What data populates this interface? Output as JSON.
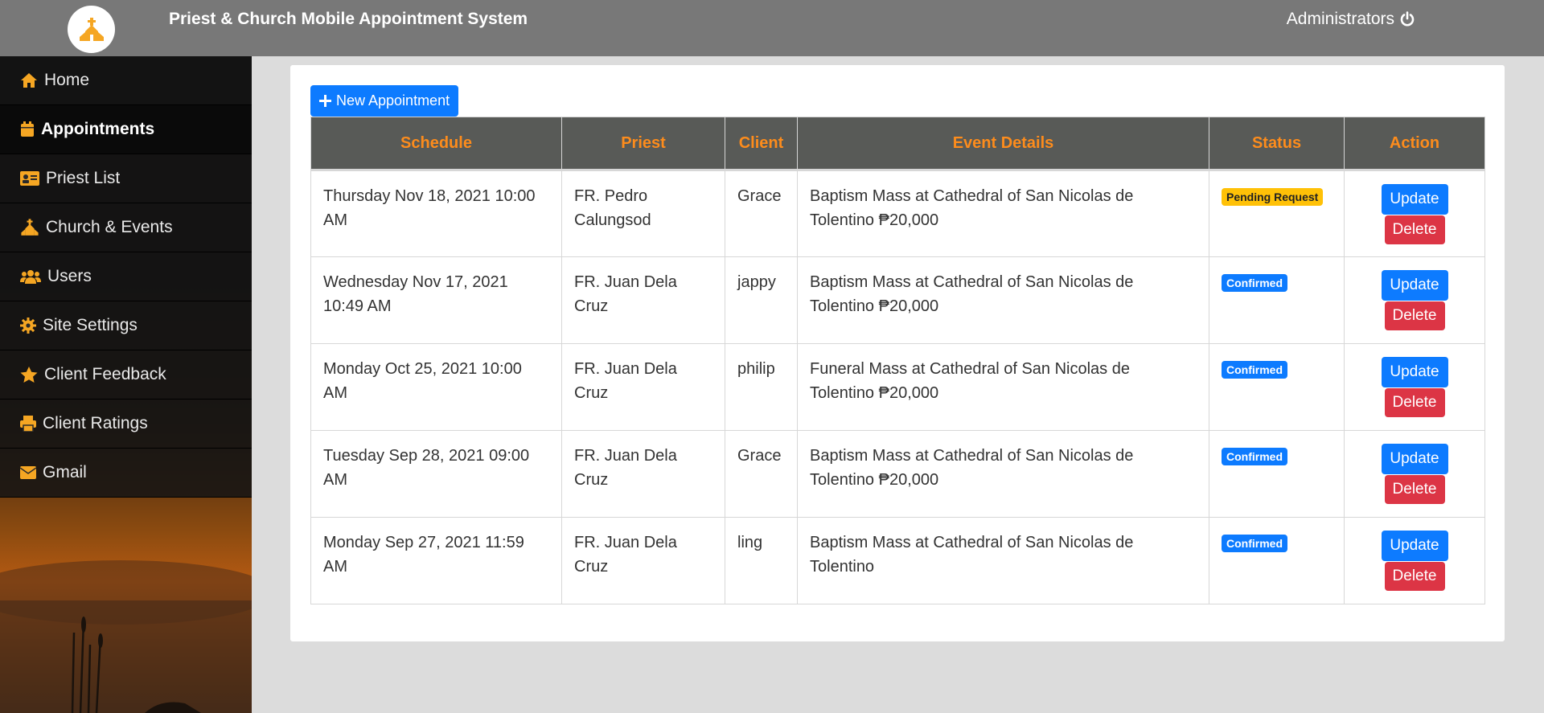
{
  "header": {
    "app_title": "Priest & Church Mobile Appointment System",
    "user_label": "Administrators",
    "logo_icon": "church-icon",
    "logout_icon": "power-icon",
    "accent_color": "#f5a623"
  },
  "sidebar": {
    "items": [
      {
        "label": "Home",
        "icon": "home-icon"
      },
      {
        "label": "Appointments",
        "icon": "calendar-icon",
        "active": true
      },
      {
        "label": "Priest List",
        "icon": "id-card-icon"
      },
      {
        "label": "Church & Events",
        "icon": "church-icon"
      },
      {
        "label": "Users",
        "icon": "users-icon"
      },
      {
        "label": "Site Settings",
        "icon": "gear-icon"
      },
      {
        "label": "Client Feedback",
        "icon": "star-icon"
      },
      {
        "label": "Client Ratings",
        "icon": "print-icon"
      },
      {
        "label": "Gmail",
        "icon": "envelope-icon"
      }
    ]
  },
  "main": {
    "new_button_label": "New Appointment",
    "table": {
      "headers": [
        "Schedule",
        "Priest",
        "Client",
        "Event Details",
        "Status",
        "Action"
      ],
      "update_label": "Update",
      "delete_label": "Delete",
      "rows": [
        {
          "schedule": "Thursday Nov 18, 2021 10:00 AM",
          "priest": "FR. Pedro Calungsod",
          "client": "Grace",
          "event": "Baptism Mass at Cathedral of San Nicolas de Tolentino ₱20,000",
          "status": "Pending Request",
          "status_color": "#ffc107"
        },
        {
          "schedule": "Wednesday Nov 17, 2021 10:49 AM",
          "priest": "FR. Juan Dela Cruz",
          "client": "jappy",
          "event": "Baptism Mass at Cathedral of San Nicolas de Tolentino ₱20,000",
          "status": "Confirmed",
          "status_color": "#0d7bff"
        },
        {
          "schedule": "Monday Oct 25, 2021 10:00 AM",
          "priest": "FR. Juan Dela Cruz",
          "client": "philip",
          "event": "Funeral Mass at Cathedral of San Nicolas de Tolentino ₱20,000",
          "status": "Confirmed",
          "status_color": "#0d7bff"
        },
        {
          "schedule": "Tuesday Sep 28, 2021 09:00 AM",
          "priest": "FR. Juan Dela Cruz",
          "client": "Grace",
          "event": "Baptism Mass at Cathedral of San Nicolas de Tolentino ₱20,000",
          "status": "Confirmed",
          "status_color": "#0d7bff"
        },
        {
          "schedule": "Monday Sep 27, 2021 11:59 AM",
          "priest": "FR. Juan Dela Cruz",
          "client": "ling",
          "event": "Baptism Mass at Cathedral of San Nicolas de Tolentino",
          "status": "Confirmed",
          "status_color": "#0d7bff"
        }
      ]
    }
  }
}
